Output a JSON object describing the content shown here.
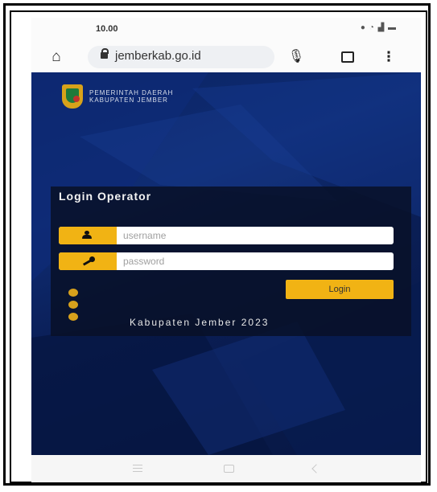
{
  "status_bar": {
    "time": "10.00",
    "icons": [
      "notification-dot-icon",
      "wifi-icon",
      "signal-icon",
      "battery-icon"
    ]
  },
  "browser": {
    "url": "jemberkab.go.id",
    "icons": [
      "home-icon",
      "lock-icon",
      "mic-icon",
      "tabs-icon",
      "more-vert-icon"
    ]
  },
  "site_header": {
    "line1": "PEMERINTAH DAERAH",
    "line2": "KABUPATEN JEMBER"
  },
  "login": {
    "title": "Login Operator",
    "username_placeholder": "username",
    "password_placeholder": "password",
    "button": "Login",
    "footer": "Kabupaten Jember 2023"
  },
  "colors": {
    "accent": "#f1b314",
    "panel": "#0a1840",
    "background": "#0c2468"
  }
}
